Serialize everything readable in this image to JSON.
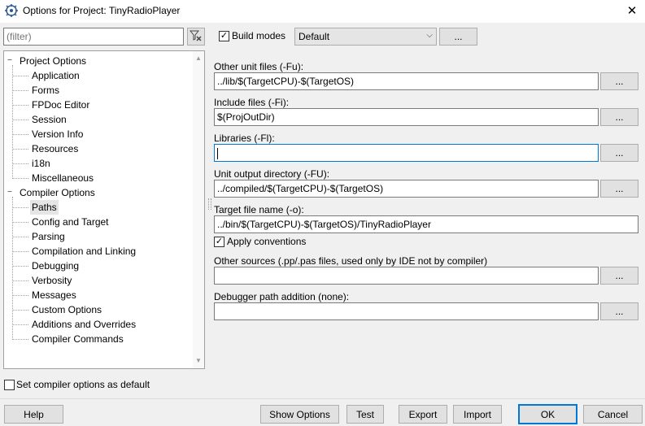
{
  "window": {
    "title": "Options for Project: TinyRadioPlayer",
    "close_glyph": "✕"
  },
  "filter": {
    "placeholder": "(filter)",
    "value": ""
  },
  "tree": {
    "items": [
      {
        "label": "Project Options",
        "level": 0,
        "expanded": true,
        "toggle": "−"
      },
      {
        "label": "Application",
        "level": 1
      },
      {
        "label": "Forms",
        "level": 1
      },
      {
        "label": "FPDoc Editor",
        "level": 1
      },
      {
        "label": "Session",
        "level": 1
      },
      {
        "label": "Version Info",
        "level": 1
      },
      {
        "label": "Resources",
        "level": 1
      },
      {
        "label": "i18n",
        "level": 1
      },
      {
        "label": "Miscellaneous",
        "level": 1
      },
      {
        "label": "Compiler Options",
        "level": 0,
        "expanded": true,
        "toggle": "−"
      },
      {
        "label": "Paths",
        "level": 1,
        "selected": true
      },
      {
        "label": "Config and Target",
        "level": 1
      },
      {
        "label": "Parsing",
        "level": 1
      },
      {
        "label": "Compilation and Linking",
        "level": 1
      },
      {
        "label": "Debugging",
        "level": 1
      },
      {
        "label": "Verbosity",
        "level": 1
      },
      {
        "label": "Messages",
        "level": 1
      },
      {
        "label": "Custom Options",
        "level": 1
      },
      {
        "label": "Additions and Overrides",
        "level": 1
      },
      {
        "label": "Compiler Commands",
        "level": 1
      }
    ]
  },
  "build_modes": {
    "checked": true,
    "label": "Build modes",
    "value": "Default",
    "button": "..."
  },
  "fields": {
    "other_units": {
      "label": "Other unit files (-Fu):",
      "value": "../lib/$(TargetCPU)-$(TargetOS)",
      "button": "..."
    },
    "include": {
      "label": "Include files (-Fi):",
      "value": "$(ProjOutDir)",
      "button": "..."
    },
    "libraries": {
      "label": "Libraries (-Fl):",
      "value": "",
      "button": "..."
    },
    "unit_output": {
      "label": "Unit output directory (-FU):",
      "value": "../compiled/$(TargetCPU)-$(TargetOS)",
      "button": "..."
    },
    "target_file": {
      "label": "Target file name (-o):",
      "value": "../bin/$(TargetCPU)-$(TargetOS)/TinyRadioPlayer"
    },
    "other_sources": {
      "label": "Other sources (.pp/.pas files, used only by IDE not by compiler)",
      "value": "",
      "button": "..."
    },
    "debugger_path": {
      "label": "Debugger path addition (none):",
      "value": "",
      "button": "..."
    }
  },
  "apply_conventions": {
    "checked": true,
    "label": "Apply conventions"
  },
  "set_default": {
    "checked": false,
    "label": "Set compiler options as default"
  },
  "buttons": {
    "help": "Help",
    "show_options": "Show Options",
    "test": "Test",
    "export": "Export",
    "import": "Import",
    "ok": "OK",
    "cancel": "Cancel"
  },
  "colors": {
    "focus": "#0078d7",
    "window_bg": "#f0f0f0",
    "selection": "#e5e5e5"
  }
}
